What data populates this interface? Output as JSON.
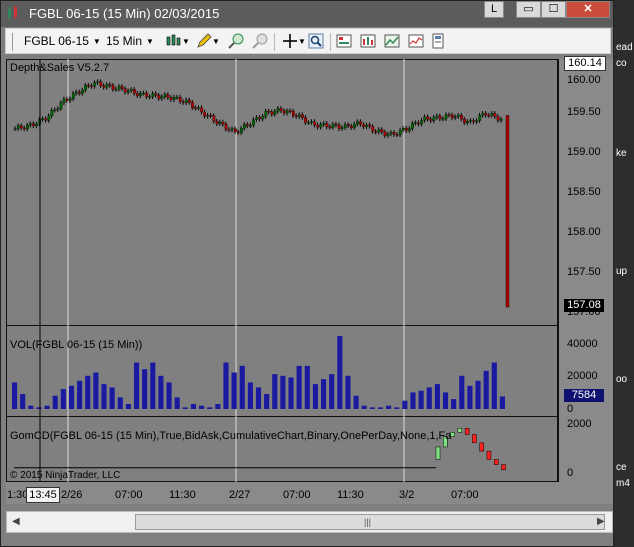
{
  "window": {
    "title": "FGBL 06-15 (15 Min)  02/03/2015",
    "controls": {
      "l": "L",
      "minimize": "▭",
      "maximize": "☐",
      "close": "✕"
    }
  },
  "toolbar": {
    "instrument": "FGBL 06-15",
    "interval": "15 Min"
  },
  "price_panel": {
    "label": "Depth&Sales V5.2.7",
    "ticks": [
      "160.14",
      "160.00",
      "159.50",
      "159.00",
      "158.50",
      "158.00",
      "157.50",
      "157.00"
    ],
    "last_price": "157.08"
  },
  "volume_panel": {
    "label": "VOL(FGBL 06-15 (15 Min))",
    "ticks": [
      "40000",
      "20000",
      "0"
    ],
    "last_volume": "7584"
  },
  "gomcd_panel": {
    "label": "GomCD(FGBL 06-15 (15 Min),True,BidAsk,CumulativeChart,Binary,OnePerDay,None,1,Fa",
    "ticks": [
      "2000",
      "0"
    ],
    "copyright": "© 2015 NinjaTrader, LLC"
  },
  "xaxis": {
    "ticks": [
      "1:30",
      "2/26",
      "07:00",
      "11:30",
      "2/27",
      "07:00",
      "11:30",
      "3/2",
      "07:00"
    ],
    "crosshair_time": "13:45"
  },
  "colors": {
    "up_candle": "#006400",
    "down_candle": "#b00000",
    "volume_bar": "#1a1aa0",
    "gomcd_up": "#7fe07f",
    "gomcd_down": "#ff2020"
  },
  "side_fragments": [
    "ead",
    "co",
    "ke",
    "up",
    "oo",
    "ce",
    "m4"
  ],
  "chart_data": [
    {
      "type": "candlestick",
      "title": "Depth&Sales V5.2.7",
      "ylim": [
        156.9,
        160.2
      ],
      "x": [
        "1:30",
        "2/26",
        "07:00",
        "11:30",
        "2/27",
        "07:00",
        "11:30",
        "3/2",
        "07:00"
      ],
      "close": [
        159.38,
        159.42,
        159.52,
        159.72,
        159.85,
        159.97,
        159.92,
        159.88,
        159.82,
        159.8,
        159.78,
        159.72,
        159.58,
        159.45,
        159.33,
        159.45,
        159.58,
        159.62,
        159.55,
        159.43,
        159.42,
        159.4,
        159.45,
        159.35,
        159.3,
        159.38,
        159.5,
        159.52,
        159.55,
        159.45,
        159.58,
        159.5,
        157.08
      ]
    },
    {
      "type": "bar",
      "title": "VOL(FGBL 06-15 (15 Min))",
      "ylim": [
        0,
        47000
      ],
      "values": [
        16000,
        9000,
        2000,
        1000,
        2000,
        8000,
        12000,
        14000,
        17000,
        20000,
        22000,
        15000,
        13000,
        7000,
        3000,
        28000,
        24000,
        28000,
        20000,
        16000,
        7000,
        1000,
        3000,
        2000,
        1000,
        3000,
        28000,
        22000,
        26000,
        16000,
        13000,
        9000,
        21000,
        20000,
        19000,
        26000,
        26000,
        15000,
        18000,
        21000,
        44000,
        20000,
        8000,
        2000,
        1000,
        1000,
        2000,
        1000,
        5000,
        10000,
        11000,
        13000,
        15000,
        10000,
        6000,
        20000,
        14000,
        17000,
        23000,
        28000,
        7584
      ]
    },
    {
      "type": "line",
      "title": "GomCD",
      "ylim": [
        -300,
        2200
      ],
      "values": [
        0,
        0,
        0,
        0,
        400,
        1000,
        1500,
        1700,
        1900,
        1600,
        1200,
        800,
        400,
        150,
        -100
      ]
    }
  ]
}
